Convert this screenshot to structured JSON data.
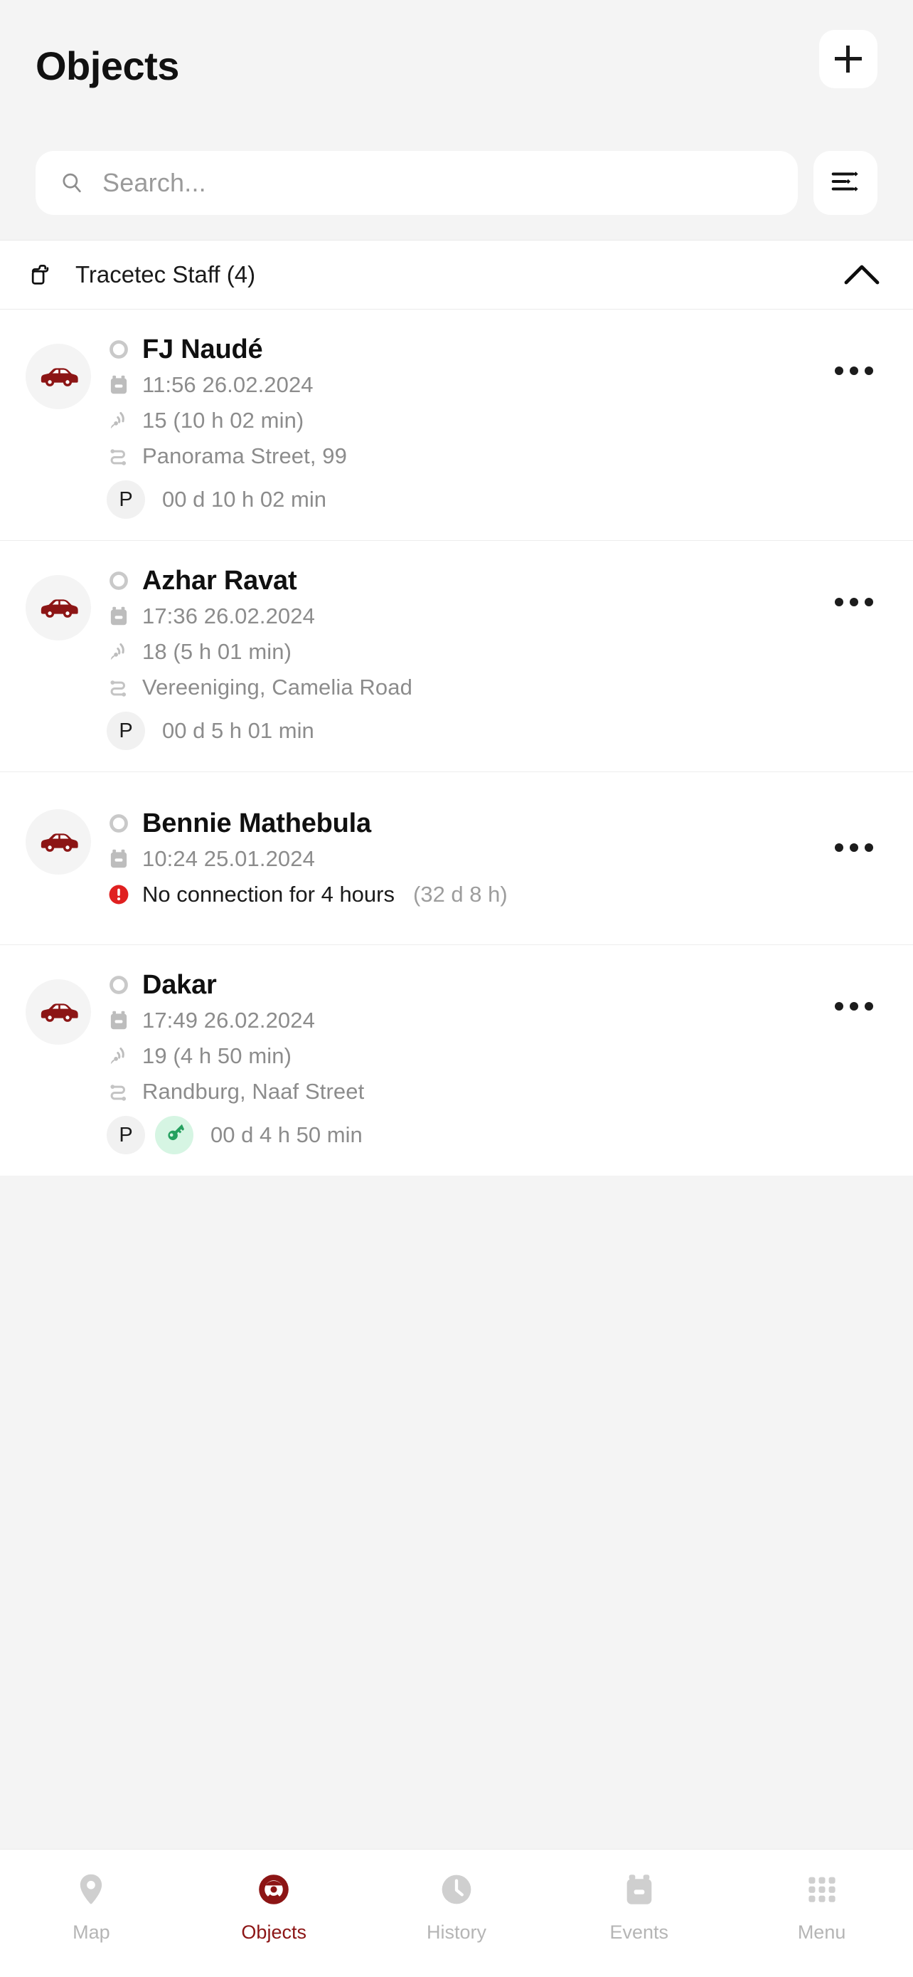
{
  "header": {
    "title": "Objects",
    "add_button_label": "+",
    "add_icon": "plus-icon",
    "filter_icon": "sliders-filter-icon"
  },
  "search": {
    "placeholder": "Search...",
    "value": "",
    "icon": "search-icon"
  },
  "group": {
    "label": "Tracetec Staff (4)",
    "icon": "folder-icon",
    "collapse_icon": "chevron-up-icon",
    "expanded": true
  },
  "colors": {
    "brand_red": "#8c1515",
    "alert_red": "#e02020",
    "green": "#25a05f",
    "green_bg": "#d6f5e3",
    "muted": "#8c8c8c",
    "page_bg": "#f4f4f4",
    "card_bg": "#ffffff"
  },
  "objects": [
    {
      "name": "FJ Naudé",
      "status_icon": "status-ring-icon",
      "vehicle_icon": "car-icon",
      "datetime": "11:56 26.02.2024",
      "datetime_icon": "battery-icon",
      "signal": "15 (10 h 02 min)",
      "signal_icon": "satellite-signal-icon",
      "address": "Panorama Street, 99",
      "address_icon": "route-icon",
      "badges": [
        {
          "label": "P",
          "kind": "parking"
        }
      ],
      "duration": "00 d 10 h 02 min",
      "menu_icon": "kebab-menu-icon",
      "alert": null
    },
    {
      "name": "Azhar Ravat",
      "status_icon": "status-ring-icon",
      "vehicle_icon": "car-icon",
      "datetime": "17:36 26.02.2024",
      "datetime_icon": "battery-icon",
      "signal": "18 (5 h 01 min)",
      "signal_icon": "satellite-signal-icon",
      "address": "Vereeniging, Camelia Road",
      "address_icon": "route-icon",
      "badges": [
        {
          "label": "P",
          "kind": "parking"
        }
      ],
      "duration": "00 d 5 h 01 min",
      "menu_icon": "kebab-menu-icon",
      "alert": null
    },
    {
      "name": "Bennie Mathebula",
      "status_icon": "status-ring-icon",
      "vehicle_icon": "car-icon",
      "datetime": "10:24 25.01.2024",
      "datetime_icon": "battery-icon",
      "signal": null,
      "signal_icon": null,
      "address": null,
      "address_icon": null,
      "badges": [],
      "duration": null,
      "menu_icon": "kebab-menu-icon",
      "alert": {
        "icon": "error-exclamation-icon",
        "text": "No connection for 4 hours",
        "sub": "(32 d 8 h)"
      }
    },
    {
      "name": "Dakar",
      "status_icon": "status-ring-icon",
      "vehicle_icon": "car-icon",
      "datetime": "17:49 26.02.2024",
      "datetime_icon": "battery-icon",
      "signal": "19 (4 h 50 min)",
      "signal_icon": "satellite-signal-icon",
      "address": "Randburg, Naaf Street",
      "address_icon": "route-icon",
      "badges": [
        {
          "label": "P",
          "kind": "parking"
        },
        {
          "label": "",
          "kind": "ignition-key"
        }
      ],
      "duration": "00 d 4 h 50 min",
      "menu_icon": "kebab-menu-icon",
      "alert": null
    }
  ],
  "bottom_nav": {
    "items": [
      {
        "label": "Map",
        "icon": "map-pin-icon",
        "active": false
      },
      {
        "label": "Objects",
        "icon": "steering-wheel-icon",
        "active": true
      },
      {
        "label": "History",
        "icon": "clock-icon",
        "active": false
      },
      {
        "label": "Events",
        "icon": "battery-events-icon",
        "active": false
      },
      {
        "label": "Menu",
        "icon": "grid-dots-icon",
        "active": false
      }
    ]
  }
}
